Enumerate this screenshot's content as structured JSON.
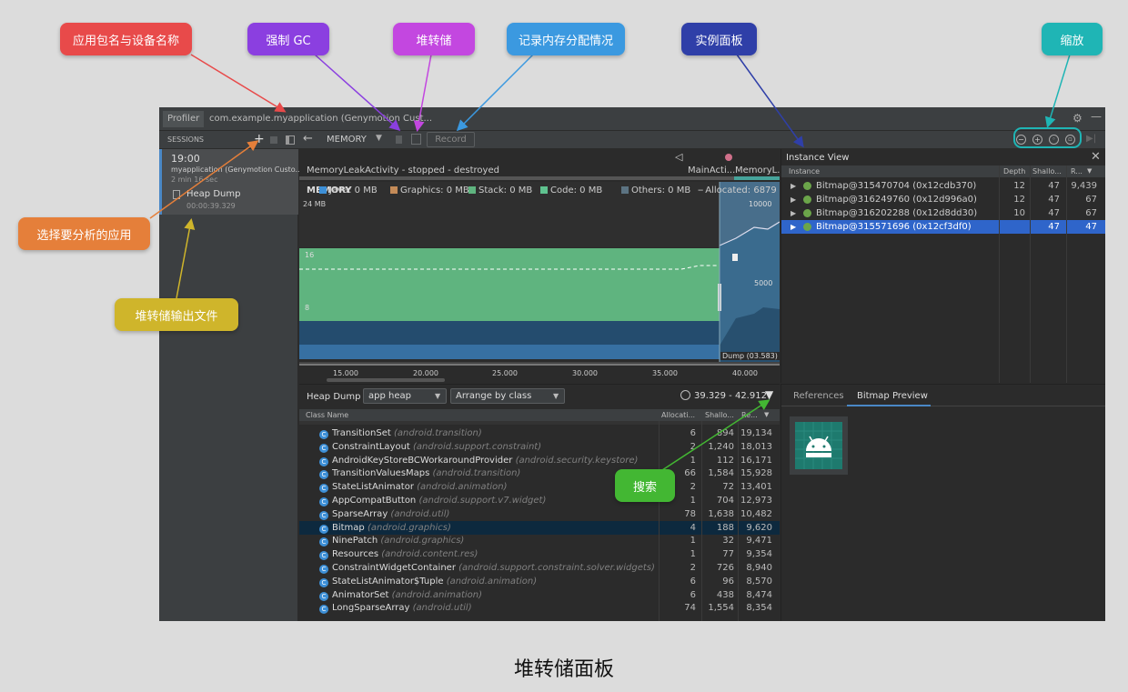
{
  "callouts": {
    "app_device": "应用包名与设备名称",
    "force_gc": "强制 GC",
    "heap_dump": "堆转储",
    "record_alloc": "记录内存分配情况",
    "instance_panel": "实例面板",
    "zoom": "缩放",
    "select_app": "选择要分析的应用",
    "heap_output": "堆转储输出文件",
    "search": "搜索"
  },
  "caption": "堆转储面板",
  "titlebar": {
    "tab_profiler": "Profiler",
    "tab_app": "com.example.myapplication (Genymotion Cust..."
  },
  "toolbar": {
    "sessions_label": "SESSIONS",
    "plus": "+",
    "memory_label": "MEMORY",
    "record_label": "Record"
  },
  "session": {
    "time": "19:00",
    "name": "myapplication (Genymotion Custo...",
    "duration": "2 min 16 sec",
    "dump_label": "Heap Dump",
    "dump_time": "00:00:39.329"
  },
  "timeline": {
    "activity": "MemoryLeakActivity - stopped - destroyed",
    "right_label1": "MainActi...",
    "right_label2": "MemoryL...",
    "legend_memory": "MEMORY",
    "legend_java": "Java: 0 MB",
    "legend_graphics": "Graphics: 0 MB",
    "legend_stack": "Stack: 0 MB",
    "legend_code": "Code: 0 MB",
    "legend_others": "Others: 0 MB",
    "legend_allocated": "Allocated: 6879",
    "y_top": "24 MB",
    "y_16": "16",
    "y_8": "8",
    "y_right_10000": "10000",
    "y_right_5000": "5000",
    "dump_marker": "Dump (03.583)",
    "x_ticks": [
      "15.000",
      "20.000",
      "25.000",
      "30.000",
      "35.000",
      "40.000"
    ]
  },
  "instance_view": {
    "title": "Instance View",
    "col_instance": "Instance",
    "col_depth": "Depth",
    "col_shallow": "Shallo...",
    "col_retained": "R...",
    "rows": [
      {
        "name": "Bitmap@315470704 (0x12cdb370)",
        "depth": "12",
        "shallow": "47",
        "retained": "9,439"
      },
      {
        "name": "Bitmap@316249760 (0x12d996a0)",
        "depth": "12",
        "shallow": "47",
        "retained": "67"
      },
      {
        "name": "Bitmap@316202288 (0x12d8dd30)",
        "depth": "10",
        "shallow": "47",
        "retained": "67"
      },
      {
        "name": "Bitmap@315571696 (0x12cf3df0)",
        "depth": "",
        "shallow": "47",
        "retained": "47"
      }
    ]
  },
  "heap": {
    "label": "Heap Dump",
    "heap_select": "app heap",
    "arrange_select": "Arrange by class",
    "range": "39.329 - 42.912",
    "col_class": "Class Name",
    "col_alloc": "Allocati...",
    "col_shallow": "Shallo...",
    "col_retained": "Re...",
    "rows": [
      {
        "name": "TransitionSet",
        "pkg": "(android.transition)",
        "alloc": "6",
        "shallow": "894",
        "retained": "19,134"
      },
      {
        "name": "ConstraintLayout",
        "pkg": "(android.support.constraint)",
        "alloc": "2",
        "shallow": "1,240",
        "retained": "18,013"
      },
      {
        "name": "AndroidKeyStoreBCWorkaroundProvider",
        "pkg": "(android.security.keystore)",
        "alloc": "1",
        "shallow": "112",
        "retained": "16,171"
      },
      {
        "name": "TransitionValuesMaps",
        "pkg": "(android.transition)",
        "alloc": "66",
        "shallow": "1,584",
        "retained": "15,928"
      },
      {
        "name": "StateListAnimator",
        "pkg": "(android.animation)",
        "alloc": "2",
        "shallow": "72",
        "retained": "13,401"
      },
      {
        "name": "AppCompatButton",
        "pkg": "(android.support.v7.widget)",
        "alloc": "1",
        "shallow": "704",
        "retained": "12,973"
      },
      {
        "name": "SparseArray",
        "pkg": "(android.util)",
        "alloc": "78",
        "shallow": "1,638",
        "retained": "10,482"
      },
      {
        "name": "Bitmap",
        "pkg": "(android.graphics)",
        "alloc": "4",
        "shallow": "188",
        "retained": "9,620"
      },
      {
        "name": "NinePatch",
        "pkg": "(android.graphics)",
        "alloc": "1",
        "shallow": "32",
        "retained": "9,471"
      },
      {
        "name": "Resources",
        "pkg": "(android.content.res)",
        "alloc": "1",
        "shallow": "77",
        "retained": "9,354"
      },
      {
        "name": "ConstraintWidgetContainer",
        "pkg": "(android.support.constraint.solver.widgets)",
        "alloc": "2",
        "shallow": "726",
        "retained": "8,940"
      },
      {
        "name": "StateListAnimator$Tuple",
        "pkg": "(android.animation)",
        "alloc": "6",
        "shallow": "96",
        "retained": "8,570"
      },
      {
        "name": "AnimatorSet",
        "pkg": "(android.animation)",
        "alloc": "6",
        "shallow": "438",
        "retained": "8,474"
      },
      {
        "name": "LongSparseArray",
        "pkg": "(android.util)",
        "alloc": "74",
        "shallow": "1,554",
        "retained": "8,354"
      }
    ]
  },
  "preview": {
    "tab_references": "References",
    "tab_bitmap": "Bitmap Preview"
  },
  "colors": {
    "java": "#3d8fd6",
    "graphics": "#c48b58",
    "stack": "#5fb47f",
    "code": "#5fc28f",
    "others": "#5c7382"
  }
}
